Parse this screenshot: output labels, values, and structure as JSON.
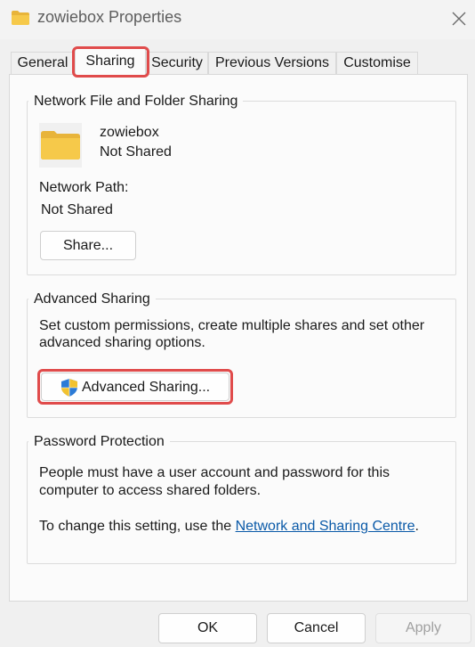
{
  "window": {
    "title": "zowiebox Properties",
    "icons": {
      "title": "folder-icon",
      "close": "close-icon"
    }
  },
  "tabs": [
    {
      "label": "General",
      "active": false
    },
    {
      "label": "Sharing",
      "active": true
    },
    {
      "label": "Security",
      "active": false
    },
    {
      "label": "Previous Versions",
      "active": false
    },
    {
      "label": "Customise",
      "active": false
    }
  ],
  "network_sharing": {
    "title": "Network File and Folder Sharing",
    "folder_name": "zowiebox",
    "folder_status": "Not Shared",
    "path_label": "Network Path:",
    "path_value": "Not Shared",
    "share_button": "Share..."
  },
  "advanced_sharing": {
    "title": "Advanced Sharing",
    "description_line1": "Set custom permissions, create multiple shares and set other",
    "description_line2": "advanced sharing options.",
    "button": "Advanced Sharing...",
    "button_icon": "uac-shield-icon"
  },
  "password_protection": {
    "title": "Password Protection",
    "line1": "People must have a user account and password for this",
    "line2": "computer to access shared folders.",
    "change_prefix": "To change this setting, use the ",
    "link": "Network and Sharing Centre",
    "change_suffix": "."
  },
  "footer": {
    "ok": "OK",
    "cancel": "Cancel",
    "apply": "Apply",
    "apply_enabled": false
  },
  "colors": {
    "highlight": "#e04b4b",
    "link": "#0b5aa8",
    "folder": "#f6c94a"
  }
}
